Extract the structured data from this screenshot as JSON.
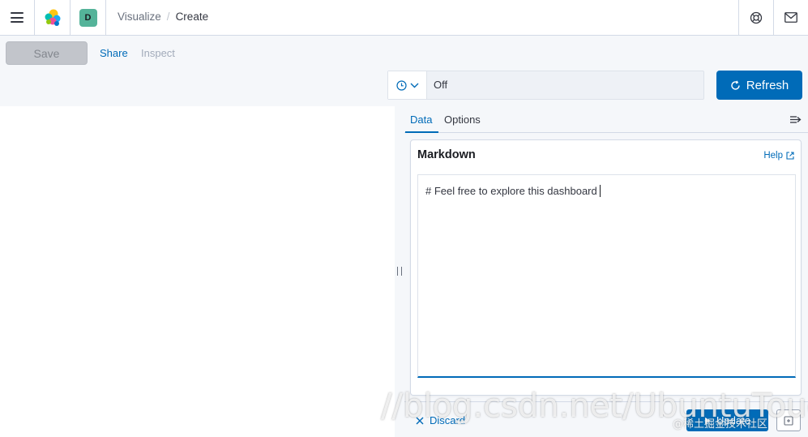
{
  "header": {
    "menu_icon": "hamburger-menu-icon",
    "logo_icon": "elastic-logo-icon",
    "space_avatar_letter": "D",
    "breadcrumbs": [
      "Visualize",
      "Create"
    ],
    "breadcrumb_separator": "/",
    "help_icon": "help-lifebuoy-icon",
    "mail_icon": "mail-icon"
  },
  "topnav": {
    "save_label": "Save",
    "share_label": "Share",
    "inspect_label": "Inspect",
    "timepicker": {
      "icon": "clock-icon",
      "refresh_interval": "Off"
    },
    "refresh_label": "Refresh"
  },
  "sidebar": {
    "tabs": [
      {
        "label": "Data",
        "active": true
      },
      {
        "label": "Options",
        "active": false
      }
    ],
    "collapse_icon": "collapse-sidebar-icon",
    "panel": {
      "title": "Markdown",
      "help_label": "Help",
      "markdown_value": "# Feel free to explore this dashboard"
    },
    "discard_label": "Discard",
    "update_label": "Update"
  },
  "watermark": {
    "main": "//blog.csdn.net/UbuntuTouch",
    "sub": "@稀土掘金技术社区"
  },
  "colors": {
    "accent": "#006bb8",
    "space_avatar": "#54b399",
    "disabled_button": "#c2c5cb",
    "surface": "#f5f7fa"
  }
}
